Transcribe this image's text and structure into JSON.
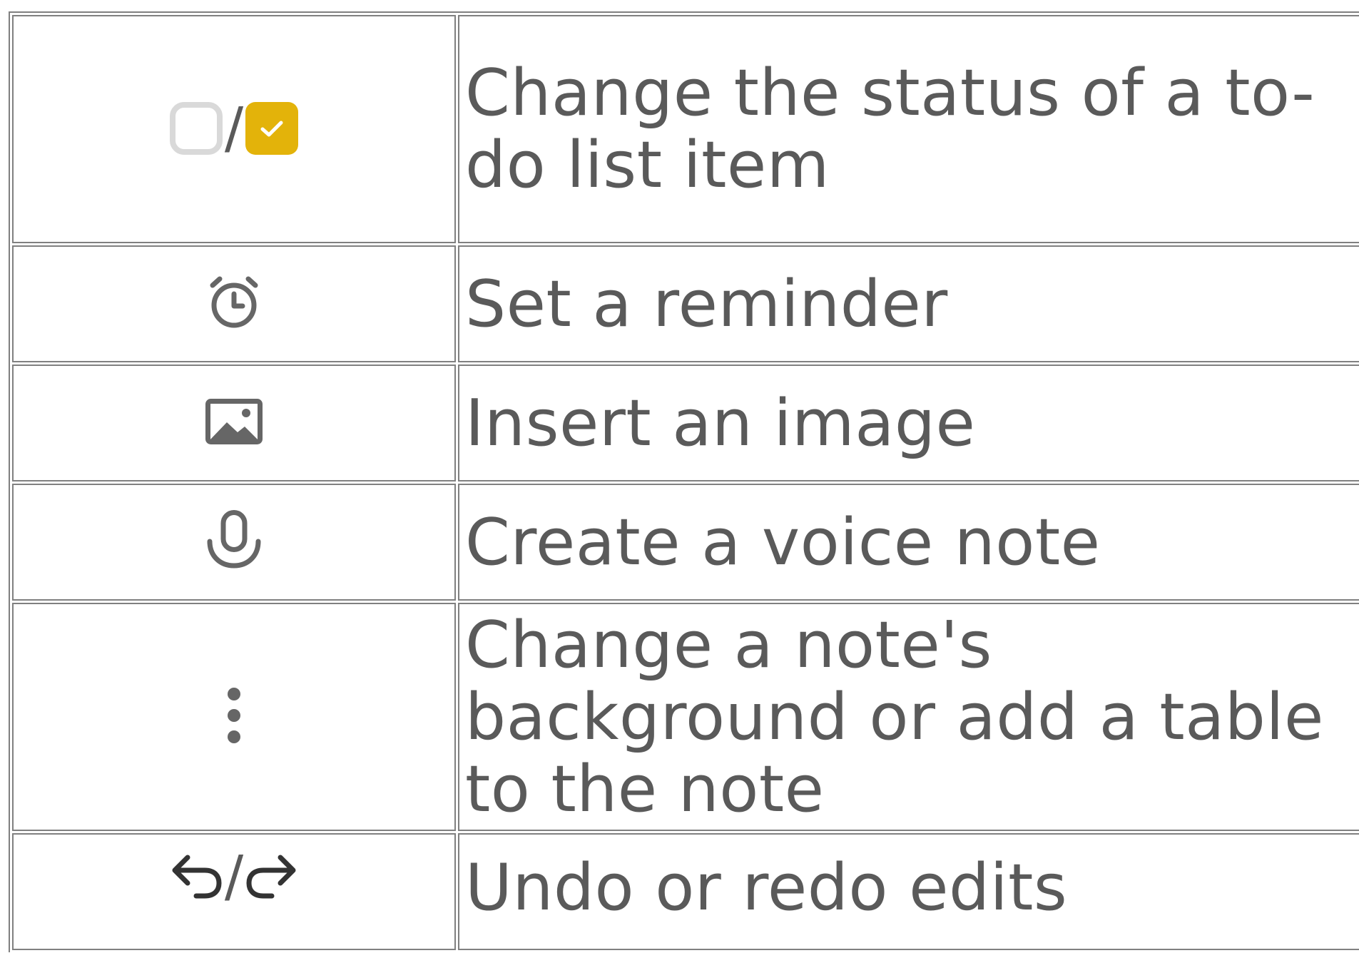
{
  "rows": [
    {
      "icons": [
        "checkbox-unchecked-icon",
        "checkbox-checked-icon"
      ],
      "separator": "/",
      "description": "Change the status of a to-do list item"
    },
    {
      "icons": [
        "alarm-clock-icon"
      ],
      "description": "Set a reminder"
    },
    {
      "icons": [
        "image-icon"
      ],
      "description": "Insert an image"
    },
    {
      "icons": [
        "microphone-icon"
      ],
      "description": "Create a voice note"
    },
    {
      "icons": [
        "more-vertical-icon"
      ],
      "description": "Change a note's background or add a table to the note"
    },
    {
      "icons": [
        "undo-icon",
        "redo-icon"
      ],
      "separator": "/",
      "description": "Undo or redo edits"
    }
  ],
  "colors": {
    "text": "#5a5a5a",
    "icon_gray": "#666666",
    "checkbox_unchecked_border": "#d9d9d9",
    "checkbox_checked_fill": "#e3b30a",
    "table_border": "#808080"
  }
}
